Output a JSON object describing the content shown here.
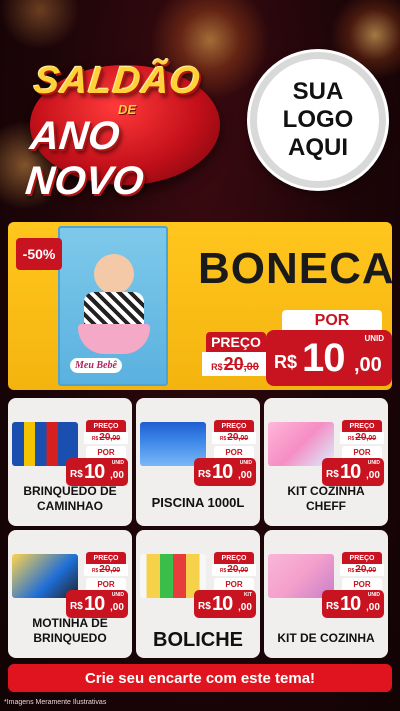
{
  "header": {
    "title_line1": "SALDÃO",
    "title_de": "DE",
    "title_line2": "ANO NOVO",
    "logo_lines": [
      "SUA",
      "LOGO",
      "AQUI"
    ]
  },
  "hero": {
    "discount": "-50%",
    "name": "BONECA",
    "preco_label": "PREÇO",
    "old_currency": "R$",
    "old_int": "20",
    "old_dec": ",00",
    "por_label": "POR",
    "currency": "R$",
    "price_int": "10",
    "price_dec": ",00",
    "unit": "UNID",
    "box_text": "Meu Bebê"
  },
  "products": [
    {
      "name": "BRINQUEDO DE CAMINHAO",
      "preco_label": "PREÇO",
      "old_currency": "R$",
      "old_int": "20",
      "old_dec": ",00",
      "por_label": "POR",
      "currency": "R$",
      "price_int": "10",
      "price_dec": ",00",
      "unit": "UNID"
    },
    {
      "name": "PISCINA 1000L",
      "preco_label": "PREÇO",
      "old_currency": "R$",
      "old_int": "20",
      "old_dec": ",00",
      "por_label": "POR",
      "currency": "R$",
      "price_int": "10",
      "price_dec": ",00",
      "unit": "UNID"
    },
    {
      "name": "KIT COZINHA CHEFF",
      "preco_label": "PREÇO",
      "old_currency": "R$",
      "old_int": "20",
      "old_dec": ",00",
      "por_label": "POR",
      "currency": "R$",
      "price_int": "10",
      "price_dec": ",00",
      "unit": "UNID"
    },
    {
      "name": "MOTINHA DE BRINQUEDO",
      "preco_label": "PREÇO",
      "old_currency": "R$",
      "old_int": "20",
      "old_dec": ",00",
      "por_label": "POR",
      "currency": "R$",
      "price_int": "10",
      "price_dec": ",00",
      "unit": "UNID"
    },
    {
      "name": "BOLICHE",
      "preco_label": "PREÇO",
      "old_currency": "R$",
      "old_int": "20",
      "old_dec": ",00",
      "por_label": "POR",
      "currency": "R$",
      "price_int": "10",
      "price_dec": ",00",
      "unit": "KIT"
    },
    {
      "name": "KIT DE COZINHA",
      "preco_label": "PREÇO",
      "old_currency": "R$",
      "old_int": "20",
      "old_dec": ",00",
      "por_label": "POR",
      "currency": "R$",
      "price_int": "10",
      "price_dec": ",00",
      "unit": "UNID"
    }
  ],
  "cta": "Crie seu encarte com este tema!",
  "footnote": "*Imagens Meramente Ilustrativas",
  "colors": {
    "accent_red": "#c81320",
    "hero_yellow": "#ffc61e",
    "title_gold": "#ffd23a"
  }
}
